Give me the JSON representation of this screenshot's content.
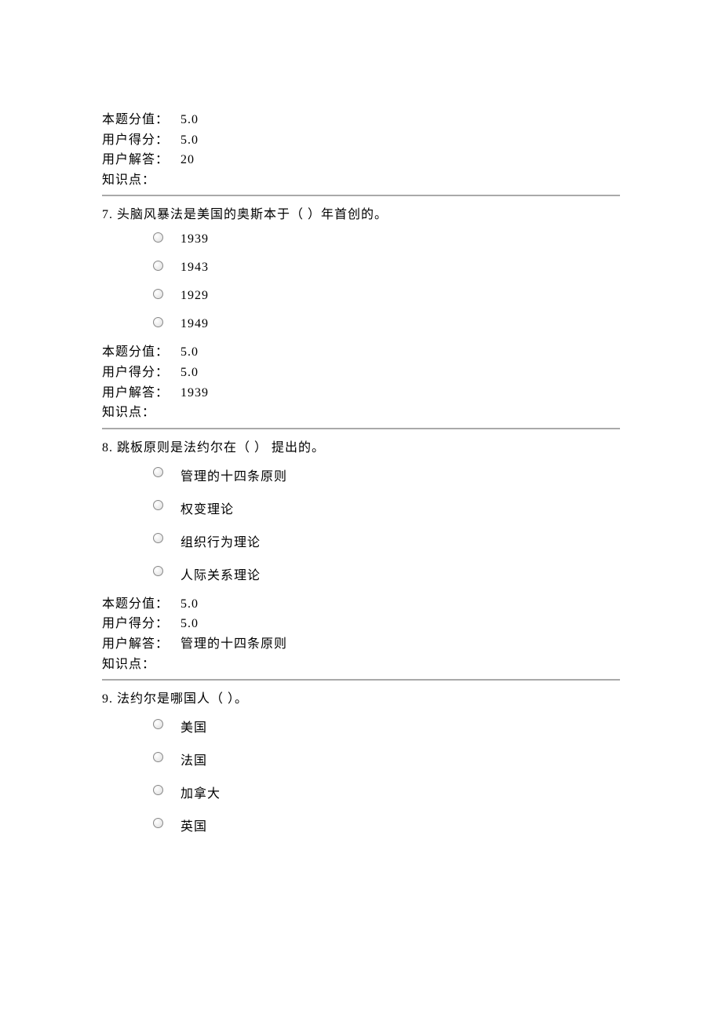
{
  "labels": {
    "fullscore": "本题分值：",
    "userscore": "用户得分：",
    "useranswer": "用户解答：",
    "knowledge": "知识点："
  },
  "q6_tail": {
    "fullscore": "5.0",
    "userscore": "5.0",
    "useranswer": "20",
    "knowledge": ""
  },
  "q7": {
    "number": "7.",
    "text": "头脑风暴法是美国的奥斯本于（ ）年首创的。",
    "options": [
      "1939",
      "1943",
      "1929",
      "1949"
    ],
    "fullscore": "5.0",
    "userscore": "5.0",
    "useranswer": "1939",
    "knowledge": ""
  },
  "q8": {
    "number": "8.",
    "text": "跳板原则是法约尔在（  ） 提出的。",
    "options": [
      "管理的十四条原则",
      "权变理论",
      "组织行为理论",
      "人际关系理论"
    ],
    "fullscore": "5.0",
    "userscore": "5.0",
    "useranswer": "管理的十四条原则",
    "knowledge": ""
  },
  "q9": {
    "number": "9.",
    "text": "法约尔是哪国人（  ）。",
    "options": [
      "美国",
      "法国",
      "加拿大",
      "英国"
    ]
  }
}
